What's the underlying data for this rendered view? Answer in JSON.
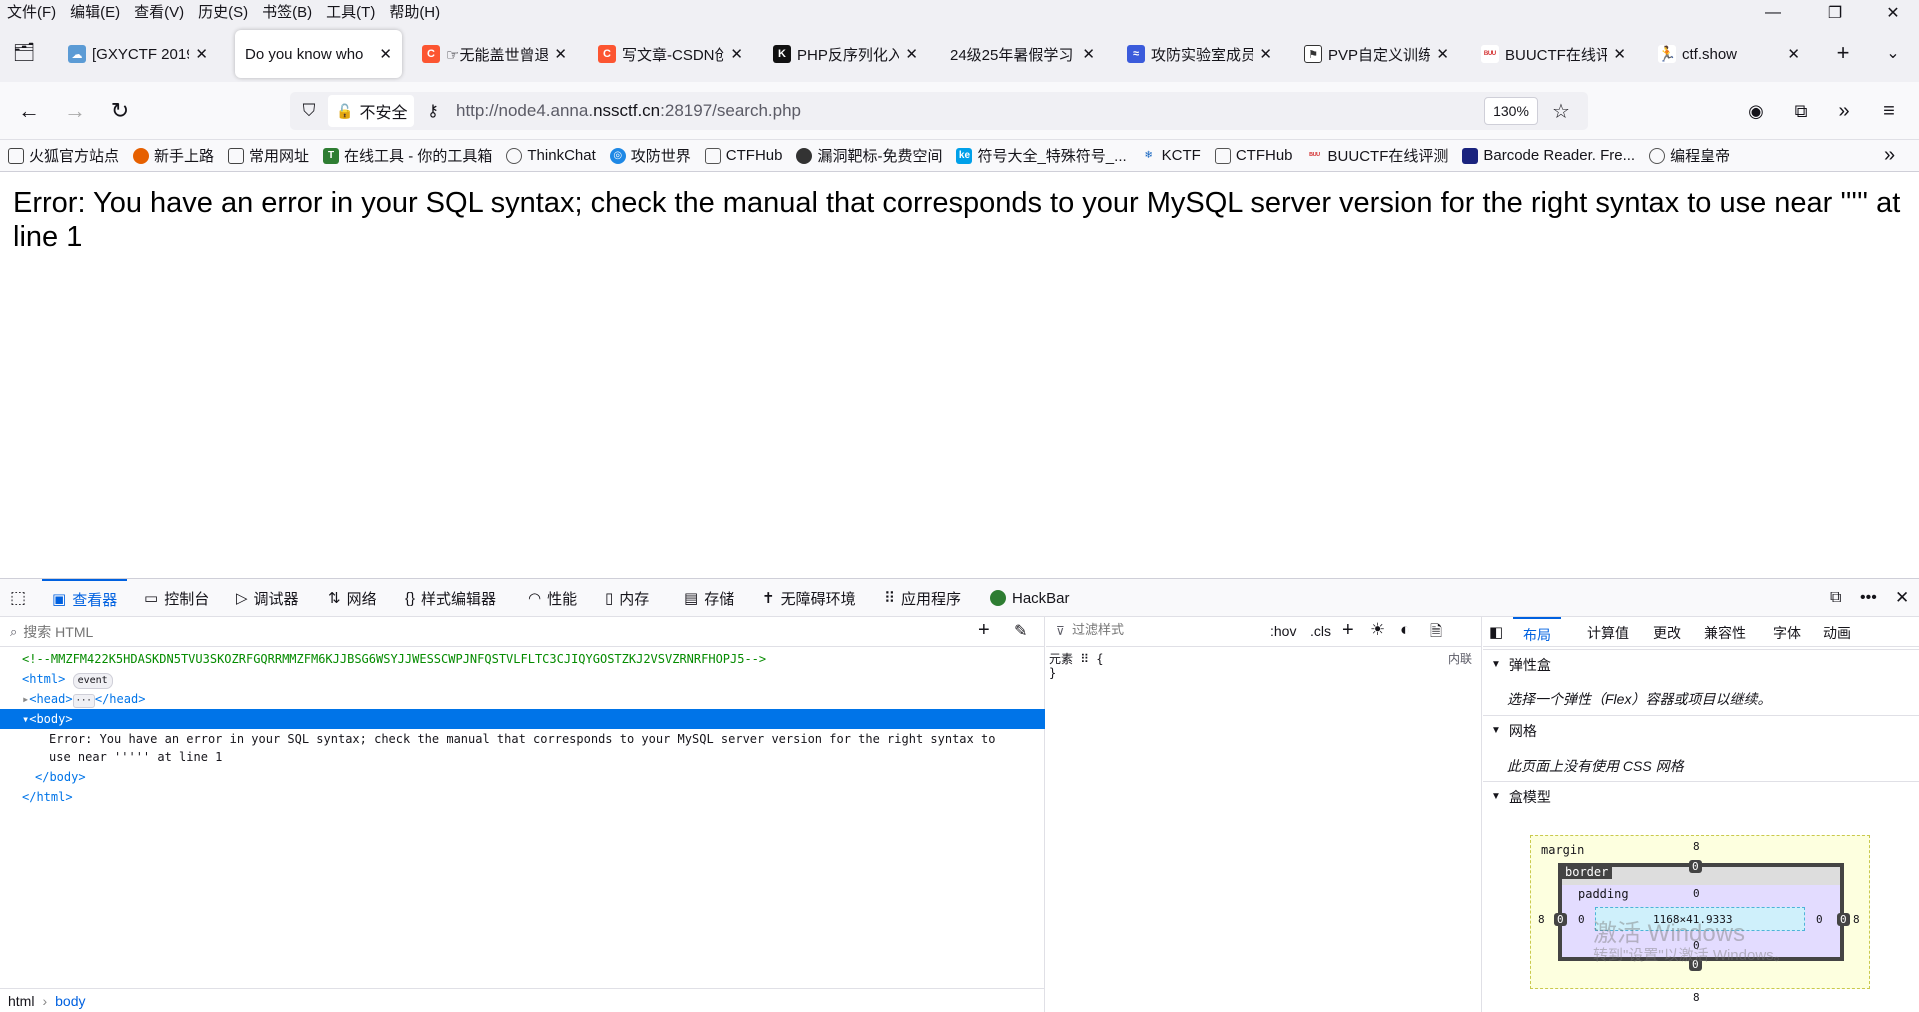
{
  "menubar": {
    "items": [
      "文件(F)",
      "编辑(E)",
      "查看(V)",
      "历史(S)",
      "书签(B)",
      "工具(T)",
      "帮助(H)"
    ]
  },
  "tabs": [
    {
      "label": "[GXYCTF 2019]",
      "color": "#5b9bd5"
    },
    {
      "label": "Do you know who",
      "color": "#ffffff"
    },
    {
      "label": "☞无能盖世曾退",
      "color": "#fc5531"
    },
    {
      "label": "写文章-CSDN创",
      "color": "#fc5531"
    },
    {
      "label": "PHP反序列化入",
      "color": "#111111"
    },
    {
      "label": "24级25年暑假学习",
      "color": "#ffffff"
    },
    {
      "label": "攻防实验室成员",
      "color": "#3b5bdb"
    },
    {
      "label": "PVP自定义训练",
      "color": "#333333"
    },
    {
      "label": "BUUCTF在线评",
      "color": "#d32f2f"
    },
    {
      "label": "ctf.show",
      "color": "#333333"
    }
  ],
  "nav": {
    "insecure_label": "不安全",
    "url_prefix": "http://node4.anna.",
    "url_domain": "nssctf.cn",
    "url_suffix": ":28197/search.php",
    "zoom": "130%"
  },
  "bookmarks": [
    {
      "label": "火狐官方站点",
      "color": "#444"
    },
    {
      "label": "新手上路",
      "color": "#e66000"
    },
    {
      "label": "常用网址",
      "color": "#444"
    },
    {
      "label": "在线工具 - 你的工具箱",
      "color": "#2e7d32"
    },
    {
      "label": "ThinkChat",
      "color": "#555"
    },
    {
      "label": "攻防世界",
      "color": "#1e88e5"
    },
    {
      "label": "CTFHub",
      "color": "#555"
    },
    {
      "label": "漏洞靶标-免费空间",
      "color": "#333"
    },
    {
      "label": "符号大全_特殊符号_...",
      "color": "#00a0e9"
    },
    {
      "label": "KCTF",
      "color": "#1565c0"
    },
    {
      "label": "CTFHub",
      "color": "#555"
    },
    {
      "label": "BUUCTF在线评测",
      "color": "#d32f2f"
    },
    {
      "label": "Barcode Reader. Fre...",
      "color": "#1a237e"
    },
    {
      "label": "编程皇帝",
      "color": "#555"
    }
  ],
  "page": {
    "error": "Error: You have an error in your SQL syntax; check the manual that corresponds to your MySQL server version for the right syntax to use near ''''' at line 1"
  },
  "devtools": {
    "tabs": [
      "查看器",
      "控制台",
      "调试器",
      "网络",
      "样式编辑器",
      "性能",
      "内存",
      "存储",
      "无障碍环境",
      "应用程序",
      "HackBar"
    ],
    "search_placeholder": "搜索 HTML",
    "comment": "<!--MMZFM422K5HDASKDN5TVU3SKOZRFGQRRMMZFM6KJJBSG6WSYJJWESSCWPJNFQSTVLFLTC3CJIQYGOSTZKJ2VSVZRNRFHOPJ5-->",
    "html_open": "<html>",
    "event_badge": "event",
    "head_open": "<head>",
    "head_close": "</head>",
    "body_open": "<body>",
    "body_text1": "Error: You have an error in your SQL syntax; check the manual that corresponds to your MySQL server version for the right syntax to",
    "body_text2": "use near ''''' at line 1",
    "body_close": "</body>",
    "html_close": "</html>",
    "breadcrumb": [
      "html",
      "body"
    ],
    "rules_filter": "过滤样式",
    "hov": ":hov",
    "cls": ".cls",
    "element_rule": "元素 ⠿ {",
    "rule_close": "}",
    "inline_label": "内联",
    "layout_tabs": [
      "布局",
      "计算值",
      "更改",
      "兼容性",
      "字体",
      "动画"
    ],
    "flex_title": "弹性盒",
    "flex_text": "选择一个弹性（Flex）容器或项目以继续。",
    "grid_title": "网格",
    "grid_text": "此页面上没有使用 CSS 网格",
    "box_title": "盒模型",
    "box": {
      "margin": "margin",
      "border": "border",
      "padding": "padding",
      "size": "1168×41.9333",
      "m": "8",
      "z": "0"
    },
    "watermark1": "激活 Windows",
    "watermark2": "转到\"设置\"以激活 Windows。"
  }
}
